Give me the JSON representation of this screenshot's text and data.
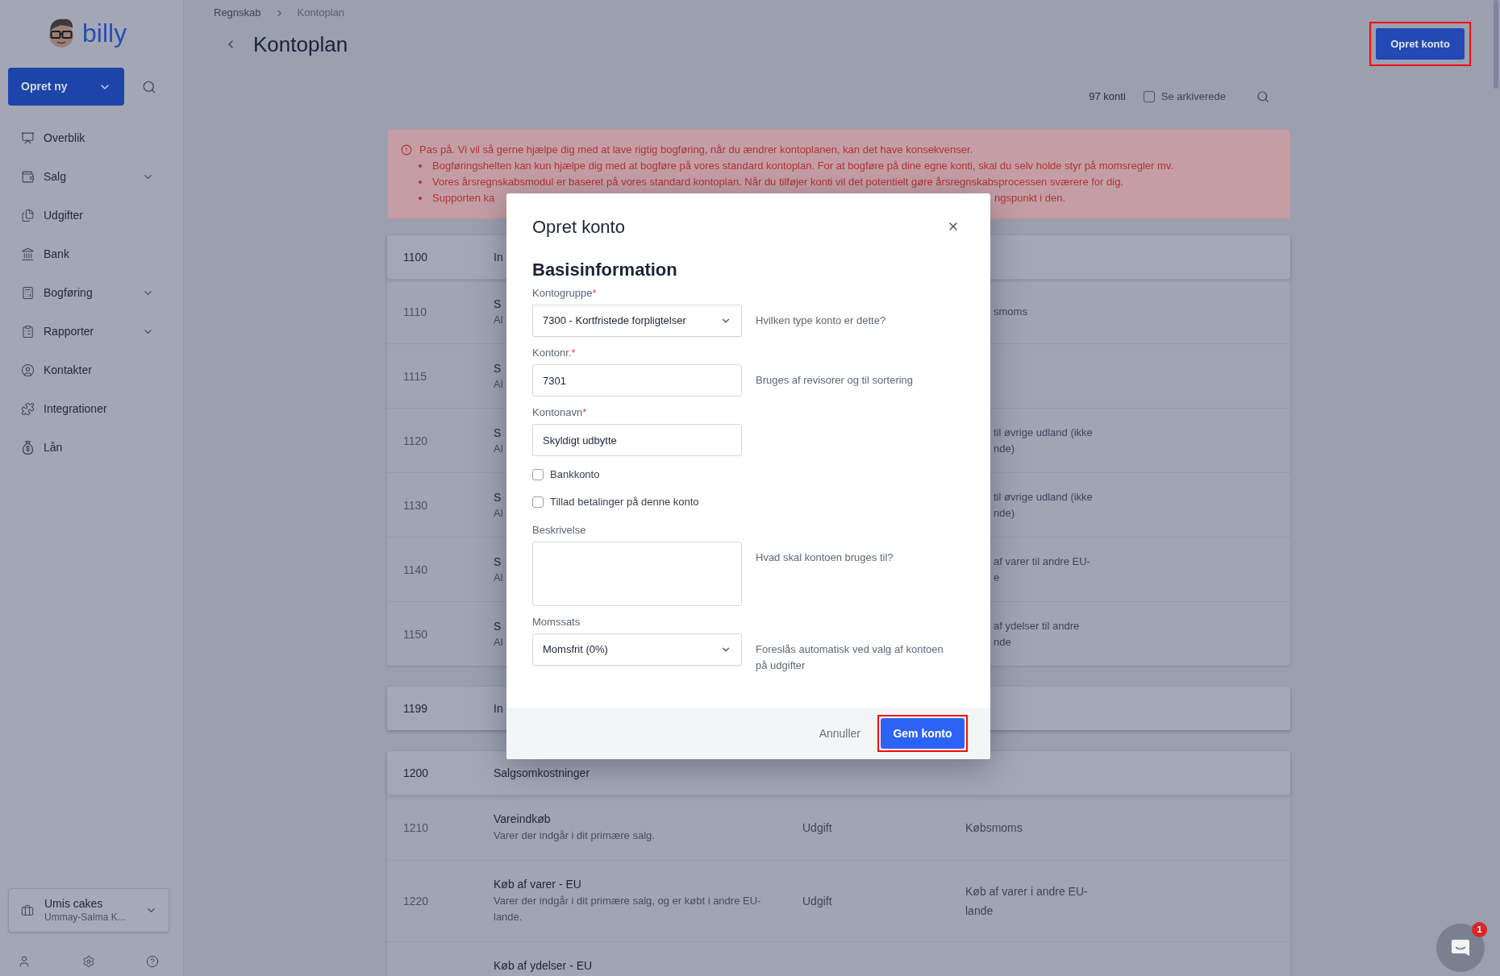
{
  "sidebar": {
    "logo": "billy",
    "create_button": "Opret ny",
    "nav_items": [
      {
        "label": "Overblik",
        "kind": "link"
      },
      {
        "label": "Salg",
        "kind": "menu"
      },
      {
        "label": "Udgifter",
        "kind": "link"
      },
      {
        "label": "Bank",
        "kind": "link"
      },
      {
        "label": "Bogføring",
        "kind": "menu"
      },
      {
        "label": "Rapporter",
        "kind": "menu"
      },
      {
        "label": "Kontakter",
        "kind": "link"
      },
      {
        "label": "Integrationer",
        "kind": "link"
      },
      {
        "label": "Lån",
        "kind": "link"
      }
    ],
    "company": {
      "name": "Umis cakes",
      "user": "Ummay-Salma K..."
    }
  },
  "breadcrumb": [
    {
      "label": "Regnskab"
    },
    {
      "label": "Kontoplan"
    }
  ],
  "header": {
    "title": "Kontoplan",
    "button": {
      "label": "Opret konto",
      "highlighted": true
    }
  },
  "toolbar": {
    "count": "97 konti",
    "archived": {
      "label": "Se arkiverede",
      "checked": false
    }
  },
  "warning": {
    "title": "Pas på. Vi vil så gerne hjælpe dig med at lave rigtig bogføring, når du ændrer kontoplanen, kan det have konsekvenser.",
    "bullets": [
      {
        "kind": "full",
        "text": "Bogføringshelten kan kun hjælpe dig med at bogføre på vores standard kontoplan. For at bogføre på dine egne konti, skal du selv holde styr på momsregler mv."
      },
      {
        "kind": "full",
        "text": "Vores årsregnskabsmodul er baseret på vores standard kontoplan. Når du tilføjer konti vil det potentielt gøre årsregnskabsprocessen sværere for dig."
      },
      {
        "kind": "split",
        "left": "Supporten ka",
        "right": "ngspunkt i den."
      }
    ]
  },
  "table": {
    "sections": [
      {
        "header": {
          "code": "1100",
          "name": "In"
        },
        "rows": [
          {
            "kind": "covered",
            "code": "1110",
            "name": "S",
            "description": "Al",
            "vat_lines": [
              "smoms"
            ]
          },
          {
            "kind": "covered",
            "code": "1115",
            "name": "S",
            "description": "Al"
          },
          {
            "kind": "covered",
            "code": "1120",
            "name": "S",
            "description": "Al",
            "vat_lines": [
              "til øvrige udland (ikke",
              "nde)"
            ]
          },
          {
            "kind": "covered",
            "code": "1130",
            "name": "S",
            "description": "Al",
            "vat_lines": [
              "til øvrige udland (ikke",
              "nde)"
            ]
          },
          {
            "kind": "covered",
            "code": "1140",
            "name": "S",
            "description": "Al",
            "vat_lines": [
              "af varer til andre EU-",
              "e"
            ]
          },
          {
            "kind": "covered",
            "code": "1150",
            "name": "S",
            "description": "Al",
            "vat_lines": [
              "af ydelser til andre",
              "nde"
            ]
          }
        ]
      },
      {
        "header": {
          "code": "1199",
          "name": "In"
        }
      },
      {
        "header": {
          "code": "1200",
          "name": "Salgsomkostninger"
        },
        "rows": [
          {
            "kind": "account",
            "code": "1210",
            "name": "Vareindkøb",
            "description": "Varer der indgår i dit primære salg.",
            "type": "Udgift",
            "vat": "Købsmoms"
          },
          {
            "kind": "account",
            "code": "1220",
            "name": "Køb af varer - EU",
            "description": "Varer der indgår i dit primære salg, og er købt i andre EU-lande.",
            "type": "Udgift",
            "vat": "Køb af varer i andre EU-lande"
          },
          {
            "kind": "account",
            "name": "Køb af ydelser - EU"
          }
        ]
      }
    ]
  },
  "modal": {
    "title": "Opret konto",
    "section_title": "Basisinformation",
    "fields": [
      {
        "kind": "select",
        "label": "Kontogruppe",
        "required_mark": "*",
        "value": "7300 - Kortfristede forpligtelser",
        "hint": "Hvilken type konto er dette?"
      },
      {
        "kind": "text",
        "label": "Kontonr.",
        "required_mark": "*",
        "value": "7301",
        "hint": "Bruges af revisorer og til sortering"
      },
      {
        "kind": "text",
        "label": "Kontonavn",
        "required_mark": "*",
        "value": "Skyldigt udbytte"
      },
      {
        "kind": "checkbox",
        "label": "Bankkonto",
        "checked": false
      },
      {
        "kind": "checkbox",
        "label": "Tillad betalinger på denne konto",
        "checked": false
      },
      {
        "kind": "textarea",
        "label": "Beskrivelse",
        "hint": "Hvad skal kontoen bruges til?"
      },
      {
        "kind": "select",
        "label": "Momssats",
        "value": "Momsfrit (0%)",
        "hint": "Foreslås automatisk ved valg af kontoen på udgifter"
      }
    ],
    "cancel": "Annuller",
    "submit": {
      "label": "Gem konto",
      "highlighted": true
    }
  },
  "chat": {
    "badge": "1"
  }
}
